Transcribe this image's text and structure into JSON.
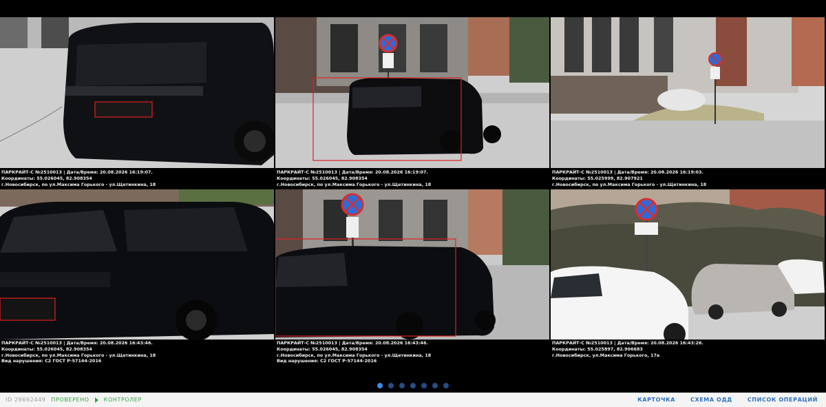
{
  "photos": [
    {
      "caption": [
        "ПАРКРАЙТ-С №2510013 | Дата/Время: 20.08.2026 16:19:07.",
        "Координаты: 55.026045, 82.908354",
        "г.Новосибирск, по ул.Максима Горького - ул.Щетинкина, 18"
      ],
      "scene": "car-closeup-rear"
    },
    {
      "caption": [
        "ПАРКРАЙТ-С №2510013 | Дата/Время: 20.08.2026 16:19:07.",
        "Координаты: 55.026045, 82.908354",
        "г.Новосибирск, по ул.Максима Горького - ул.Щетинкина, 18"
      ],
      "scene": "car-street-sign"
    },
    {
      "caption": [
        "ПАРКРАЙТ-С №2510013 | Дата/Время: 20.08.2026 16:19:03.",
        "Координаты: 55.025999, 82.907921",
        "г.Новосибирск, по ул.Максима Горького - ул.Щетинкина, 18"
      ],
      "scene": "street-empty"
    },
    {
      "caption": [
        "ПАРКРАЙТ-С №2510013 | Дата/Время: 20.08.2026 16:43:46.",
        "Координаты: 55.026045, 82.908354",
        "г.Новосибирск, по ул.Максима Горького - ул.Щетинкина, 18",
        "Вид нарушения: С2 ГОСТ Р-57144-2016"
      ],
      "scene": "car-closeup-side"
    },
    {
      "caption": [
        "ПАРКРАЙТ-С №2510013 | Дата/Время: 20.08.2026 16:43:46.",
        "Координаты: 55.026045, 82.908354",
        "г.Новосибирск, по ул.Максима Горького - ул.Щетинкина, 18",
        "Вид нарушения: С2 ГОСТ Р-57144-2016"
      ],
      "scene": "car-street-sign-2"
    },
    {
      "caption": [
        "ПАРКРАЙТ-С №2510013 | Дата/Время: 20.08.2026 16:43:26.",
        "Координаты: 55.025897, 82.906683",
        "г.Новосибирск, ул.Максима Горького, 17а"
      ],
      "scene": "parked-cars-hedge"
    }
  ],
  "pagination": {
    "count": 7,
    "active_index": 0
  },
  "footer": {
    "id_label": "ID 29692449",
    "status": "ПРОВЕРЕНО",
    "role": "КОНТРОЛЕР",
    "links": [
      "КАРТОЧКА",
      "СХЕМА ОДД",
      "СПИСОК ОПЕРАЦИЙ"
    ]
  },
  "colors": {
    "background": "#000000",
    "highlight_box": "#e02020",
    "status_green": "#37a043",
    "link_blue": "#2c6fc1",
    "dot_active": "#3c8ae6",
    "dot_inactive": "#274d86"
  }
}
